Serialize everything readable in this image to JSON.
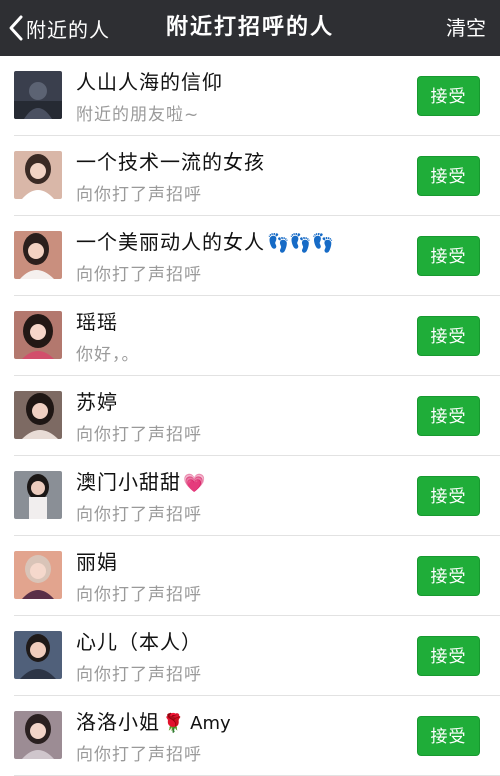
{
  "nav": {
    "back_label": "附近的人",
    "title": "附近打招呼的人",
    "clear_label": "清空"
  },
  "accept_label": "接受",
  "items": [
    {
      "name": "人山人海的信仰",
      "emoji": "",
      "message": "附近的朋友啦~",
      "avatar_color": "#3a3f4d"
    },
    {
      "name": "一个技术一流的女孩",
      "emoji": "",
      "message": "向你打了声招呼",
      "avatar_color": "#d9b7a8"
    },
    {
      "name": "一个美丽动人的女人",
      "emoji": "👣👣👣",
      "message": "向你打了声招呼",
      "avatar_color": "#c98f7e"
    },
    {
      "name": "瑶瑶",
      "emoji": "",
      "message": "你好，。",
      "avatar_color": "#b3786e"
    },
    {
      "name": "苏婷",
      "emoji": "",
      "message": "向你打了声招呼",
      "avatar_color": "#7d6a63"
    },
    {
      "name": "澳门小甜甜",
      "emoji": "💗",
      "message": "向你打了声招呼",
      "avatar_color": "#8a8f96"
    },
    {
      "name": "丽娟",
      "emoji": "",
      "message": "向你打了声招呼",
      "avatar_color": "#e2a48e"
    },
    {
      "name": "心儿（本人）",
      "emoji": "",
      "message": "向你打了声招呼",
      "avatar_color": "#50607a"
    },
    {
      "name": "洛洛小姐",
      "emoji": "🌹 Amy",
      "message": "向你打了声招呼",
      "avatar_color": "#9c8c94"
    }
  ],
  "colors": {
    "nav_bg": "#2e2f33",
    "accept_bg": "#1fad39",
    "subtext": "#9a9a9a"
  }
}
